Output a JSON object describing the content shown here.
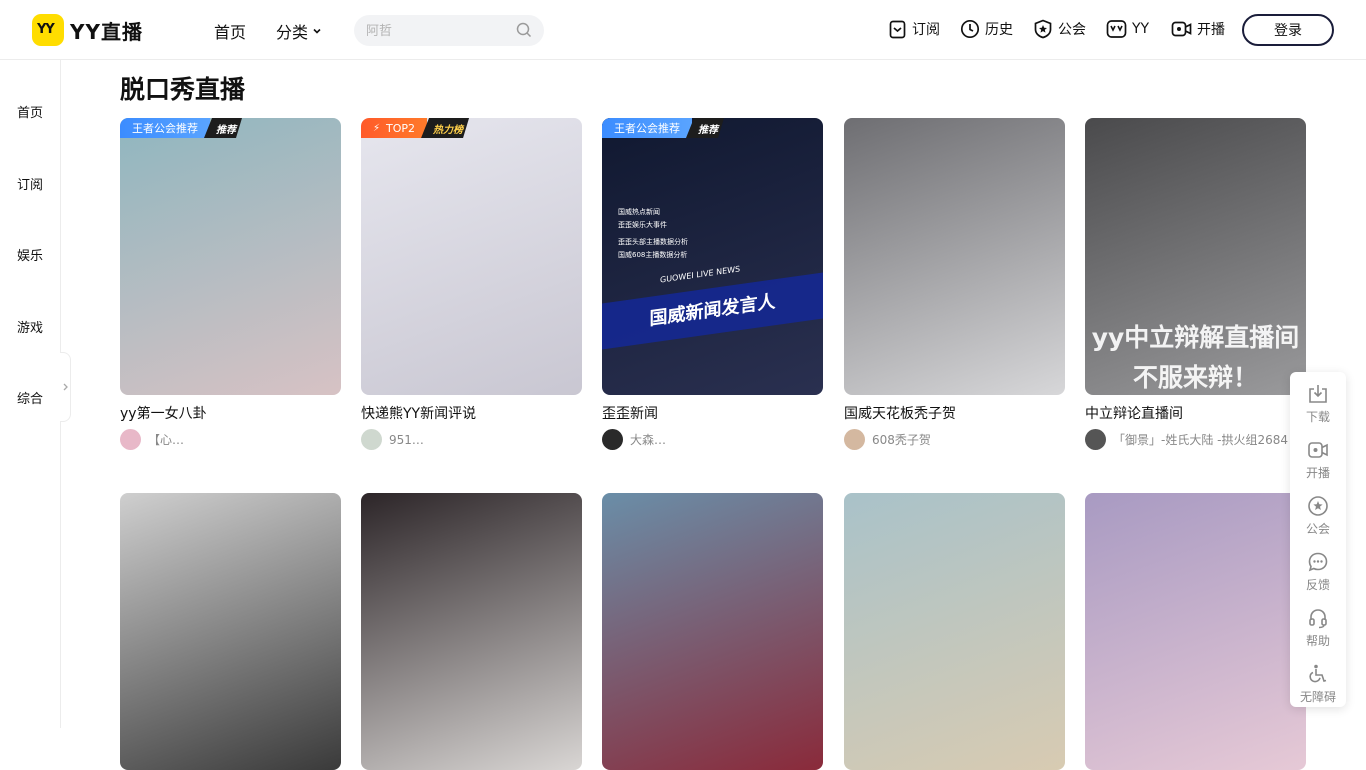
{
  "header": {
    "logo_mark": "YY",
    "logo_text": "YY直播",
    "nav_home": "首页",
    "nav_category": "分类",
    "search_placeholder": "阿哲",
    "nav": [
      {
        "label": "订阅",
        "icon": "subscribe-icon"
      },
      {
        "label": "历史",
        "icon": "history-icon"
      },
      {
        "label": "公会",
        "icon": "guild-icon"
      },
      {
        "label": "YY",
        "icon": "yy-icon"
      },
      {
        "label": "开播",
        "icon": "broadcast-icon"
      }
    ],
    "login": "登录"
  },
  "sidebar": {
    "items": [
      "首页",
      "订阅",
      "娱乐",
      "游戏",
      "综合"
    ]
  },
  "section_title": "脱口秀直播",
  "cards": [
    {
      "title": "yy第一女八卦",
      "author": "【心…",
      "badge_main": "王者公会推荐",
      "badge_tag": "推荐",
      "badge_style": "blue",
      "colors": [
        "#8fb6bf",
        "#d7c2c4"
      ],
      "avatar_color": "#e8b8c8"
    },
    {
      "title": "快递熊YY新闻评说",
      "author": "951…",
      "badge_main": "TOP2",
      "badge_tag": "热力榜",
      "badge_style": "hot",
      "colors": [
        "#e6e6ee",
        "#c9c7d2"
      ],
      "avatar_color": "#cfd8cf"
    },
    {
      "title": "歪歪新闻",
      "author": "大森…",
      "badge_main": "王者公会推荐",
      "badge_tag": "推荐",
      "badge_style": "blue",
      "colors": [
        "#101830",
        "#2a3050"
      ],
      "avatar_color": "#2a2a2a",
      "banner": "国威新闻发言人",
      "banner_sub": "GUOWEI LIVE NEWS",
      "lines": [
        "国威热点新闻",
        "歪歪娱乐大事件",
        "歪歪头部主播数据分析",
        "国威608主播数据分析"
      ]
    },
    {
      "title": "国威天花板秃子贺",
      "author": "608秃子贺",
      "colors": [
        "#6e6e72",
        "#d7d7d9"
      ],
      "avatar_color": "#d4b8a0"
    },
    {
      "title": "中立辩论直播间",
      "author": "「御景」-姓氏大陆 -拱火组2684",
      "colors": [
        "#4a4a4c",
        "#9a9a9c"
      ],
      "avatar_color": "#555",
      "overlay": [
        "yy中立辩解直播间",
        "不服来辩！"
      ]
    },
    {
      "title": "",
      "author": "",
      "colors": [
        "#cfcfcf",
        "#3a3a3a"
      ],
      "avatar_color": ""
    },
    {
      "title": "",
      "author": "",
      "colors": [
        "#2c2528",
        "#d9d6d4"
      ],
      "avatar_color": ""
    },
    {
      "title": "",
      "author": "",
      "colors": [
        "#6a8ea8",
        "#8a2a3a"
      ],
      "avatar_color": ""
    },
    {
      "title": "",
      "author": "",
      "colors": [
        "#a9c2c9",
        "#d8cbb2"
      ],
      "avatar_color": ""
    },
    {
      "title": "",
      "author": "",
      "colors": [
        "#a89ac2",
        "#e6c9d6"
      ],
      "avatar_color": ""
    }
  ],
  "float_bar": [
    {
      "label": "下载",
      "icon": "download-icon"
    },
    {
      "label": "开播",
      "icon": "broadcast-icon"
    },
    {
      "label": "公会",
      "icon": "guild-icon"
    },
    {
      "label": "反馈",
      "icon": "feedback-icon"
    },
    {
      "label": "帮助",
      "icon": "help-icon"
    },
    {
      "label": "无障碍",
      "icon": "accessibility-icon"
    }
  ]
}
